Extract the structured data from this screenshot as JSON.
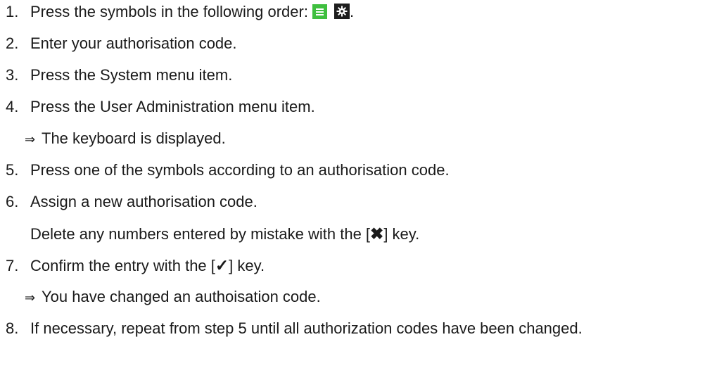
{
  "steps": [
    {
      "number": "1.",
      "before": "Press the symbols in the following order:",
      "after": ".",
      "icons": [
        "menu-icon",
        "settings-gear-icon"
      ],
      "icon_colors": {
        "menu": "#3fbf3f",
        "gear": "#1e1e1e"
      }
    },
    {
      "number": "2.",
      "text": "Enter your authorisation code."
    },
    {
      "number": "3.",
      "text": "Press the System menu item."
    },
    {
      "number": "4.",
      "text": "Press the User Administration menu item.",
      "result_arrow": "⇒",
      "result": "The keyboard is displayed."
    },
    {
      "number": "5.",
      "text": "Press one of the symbols according to an authorisation code."
    },
    {
      "number": "6.",
      "text": "Assign a new authorisation code.",
      "note_before": "Delete any numbers entered by mistake with the [",
      "note_key": "✖",
      "note_after": "] key."
    },
    {
      "number": "7.",
      "text_before": "Confirm the entry with the [",
      "key": "✓",
      "text_after": "] key.",
      "result_arrow": "⇒",
      "result": "You have changed an authoisation code."
    },
    {
      "number": "8.",
      "text": "If necessary, repeat from step 5 until all authorization codes have been changed."
    }
  ]
}
